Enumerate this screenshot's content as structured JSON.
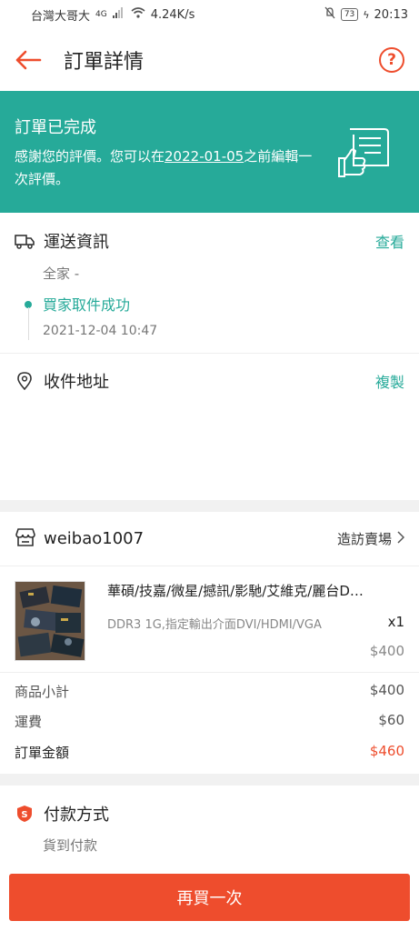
{
  "status_bar": {
    "carrier": "台灣大哥大",
    "network": "4G",
    "speed": "4.24K/s",
    "battery": "73",
    "time": "20:13"
  },
  "header": {
    "title": "訂單詳情",
    "help_icon": "?"
  },
  "banner": {
    "status": "訂單已完成",
    "message_before": "感謝您的評價。您可以在",
    "message_date": "2022-01-05",
    "message_after": "之前編輯一次評價。"
  },
  "shipping": {
    "label": "運送資訊",
    "action": "查看",
    "carrier": "全家 -",
    "status": "買家取件成功",
    "timestamp": "2021-12-04 10:47"
  },
  "address": {
    "label": "收件地址",
    "action": "複製"
  },
  "shop": {
    "name": "weibao1007",
    "visit_label": "造訪賣場"
  },
  "product": {
    "name": "華碩/技嘉/微星/撼訊/影馳/艾維克/麗台D…",
    "variation": "DDR3 1G,指定輸出介面DVI/HDMI/VGA",
    "quantity": "x1",
    "price": "$400"
  },
  "summary": {
    "subtotal_label": "商品小計",
    "subtotal_value": "$400",
    "shipping_label": "運費",
    "shipping_value": "$60",
    "total_label": "訂單金額",
    "total_value": "$460"
  },
  "payment": {
    "label": "付款方式",
    "method": "貨到付款"
  },
  "bottom": {
    "buy_again_label": "再買一次"
  },
  "colors": {
    "accent": "#ee4d2d",
    "teal": "#26aa99"
  }
}
